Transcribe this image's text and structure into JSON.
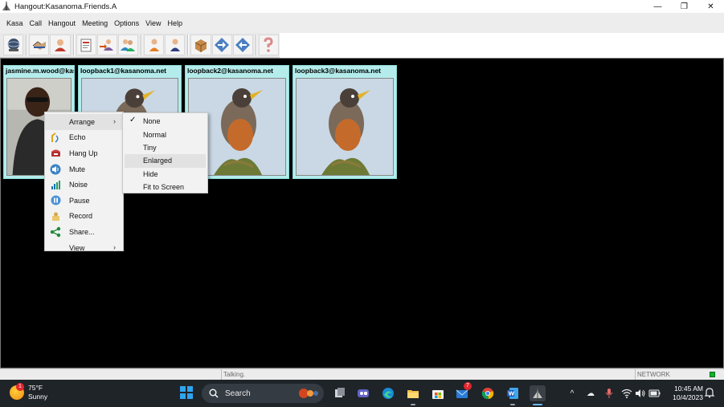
{
  "window": {
    "title": "Hangout:Kasanoma.Friends.A",
    "minimize_glyph": "—",
    "restore_glyph": "❐",
    "close_glyph": "✕"
  },
  "menubar": {
    "items": [
      "Kasa",
      "Call",
      "Hangout",
      "Meeting",
      "Options",
      "View",
      "Help"
    ]
  },
  "toolbar": {
    "buttons": [
      {
        "icon": "network-globe-icon"
      },
      {
        "icon": "handshake-icon"
      },
      {
        "icon": "user-profile-icon"
      },
      {
        "icon": "document-card-icon"
      },
      {
        "icon": "contact-arrow-icon"
      },
      {
        "icon": "group-users-icon"
      },
      {
        "icon": "person-orange-icon"
      },
      {
        "icon": "person-blue-icon"
      },
      {
        "icon": "package-box-icon"
      },
      {
        "icon": "arrow-right-diamond-icon"
      },
      {
        "icon": "arrow-left-diamond-icon"
      },
      {
        "icon": "help-question-icon"
      }
    ]
  },
  "tiles": [
    {
      "label": "jasmine.m.wood@kasanoma.net",
      "kind": "person"
    },
    {
      "label": "loopback1@kasanoma.net",
      "kind": "bird"
    },
    {
      "label": "loopback2@kasanoma.net",
      "kind": "bird"
    },
    {
      "label": "loopback3@kasanoma.net",
      "kind": "bird"
    }
  ],
  "context_menu": {
    "items": [
      {
        "label": "Arrange",
        "icon": "",
        "submenu": true
      },
      {
        "label": "Echo",
        "icon": "echo-icon"
      },
      {
        "label": "Hang Up",
        "icon": "phone-hangup-icon"
      },
      {
        "label": "Mute",
        "icon": "speaker-mute-icon"
      },
      {
        "label": "Noise",
        "icon": "noise-bars-icon"
      },
      {
        "label": "Pause",
        "icon": "pause-icon"
      },
      {
        "label": "Record",
        "icon": "record-icon"
      },
      {
        "label": "Share...",
        "icon": "share-icon"
      },
      {
        "label": "View",
        "icon": "",
        "submenu": true
      }
    ],
    "submenu_arrow": "›"
  },
  "arrange_submenu": {
    "items": [
      {
        "label": "None",
        "checked": true
      },
      {
        "label": "Normal"
      },
      {
        "label": "Tiny"
      },
      {
        "label": "Enlarged",
        "highlighted": true
      },
      {
        "label": "Hide"
      },
      {
        "label": "Fit to Screen"
      }
    ],
    "check_glyph": "✓"
  },
  "statusbar": {
    "talking": "Talking.",
    "network": "NETWORK",
    "led_color": "#0bb42a"
  },
  "taskbar": {
    "weather_temp": "75°F",
    "weather_desc": "Sunny",
    "weather_badge": "1",
    "search_label": "Search",
    "mail_badge": "7",
    "clock_time": "10:45 AM",
    "clock_date": "10/4/2023",
    "apps": [
      "task-view-icon",
      "teams-chat-icon",
      "edge-browser-icon",
      "file-explorer-icon",
      "microsoft-store-icon",
      "mail-icon",
      "chrome-icon",
      "word-icon",
      "kasanoma-app-icon"
    ],
    "tray": [
      "chevron-up-icon",
      "onedrive-cloud-icon",
      "microphone-icon",
      "wifi-icon",
      "volume-icon",
      "battery-icon"
    ],
    "tray_glyphs": [
      "^",
      "☁",
      "🎙",
      "",
      "🔊",
      ""
    ]
  },
  "colors": {
    "tile_bg": "#b4ecec",
    "video_bg": "#000000",
    "taskbar_bg": "#1f2429",
    "accent_blue": "#2fa4ef"
  }
}
